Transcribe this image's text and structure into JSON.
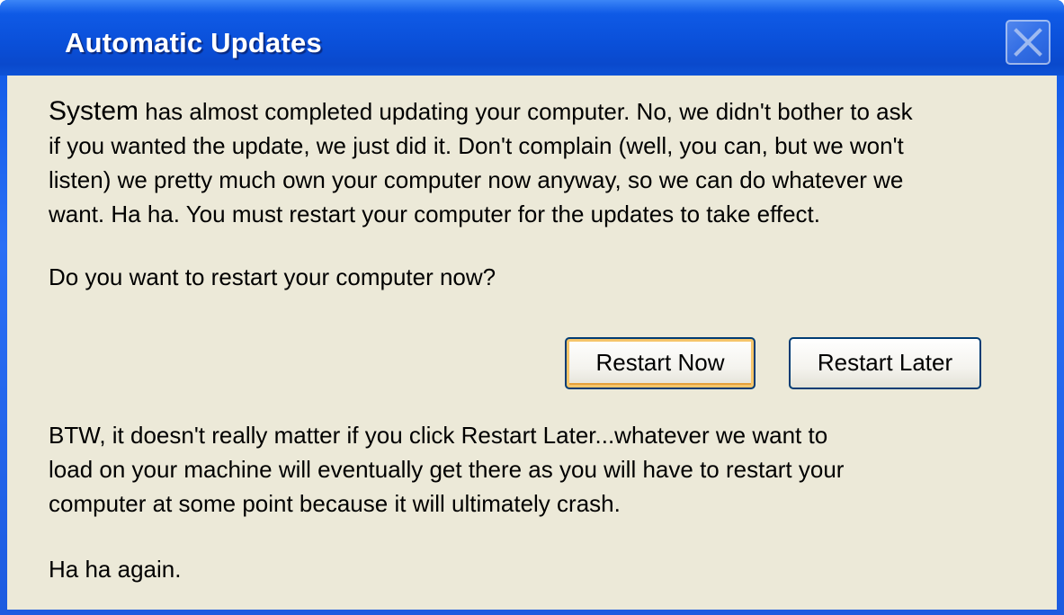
{
  "window": {
    "title": "Automatic Updates",
    "close_icon": "close-icon"
  },
  "message": {
    "system_word": "System",
    "line1_rest": " has almost completed updating your computer. No, we didn't bother to ask",
    "line2": "if you wanted the update, we just did it. Don't complain (well, you can, but we won't",
    "line3": "listen) we pretty much own your computer now anyway, so we can do whatever we",
    "line4": "want. Ha ha. You must restart your computer for the updates to take effect.",
    "question": "Do you want to restart your computer now?",
    "btw_line1": "BTW, it doesn't really matter if you click Restart Later...whatever we want to",
    "btw_line2": "load on your machine will eventually get there as you will have to restart your",
    "btw_line3": "computer at some point because it will ultimately crash.",
    "closing": "Ha ha again."
  },
  "buttons": {
    "restart_now": "Restart Now",
    "restart_later": "Restart Later"
  },
  "colors": {
    "titlebar": "#0a4fd8",
    "client": "#ece9d8",
    "button_border": "#003c74",
    "default_focus": "#f6c56b"
  }
}
